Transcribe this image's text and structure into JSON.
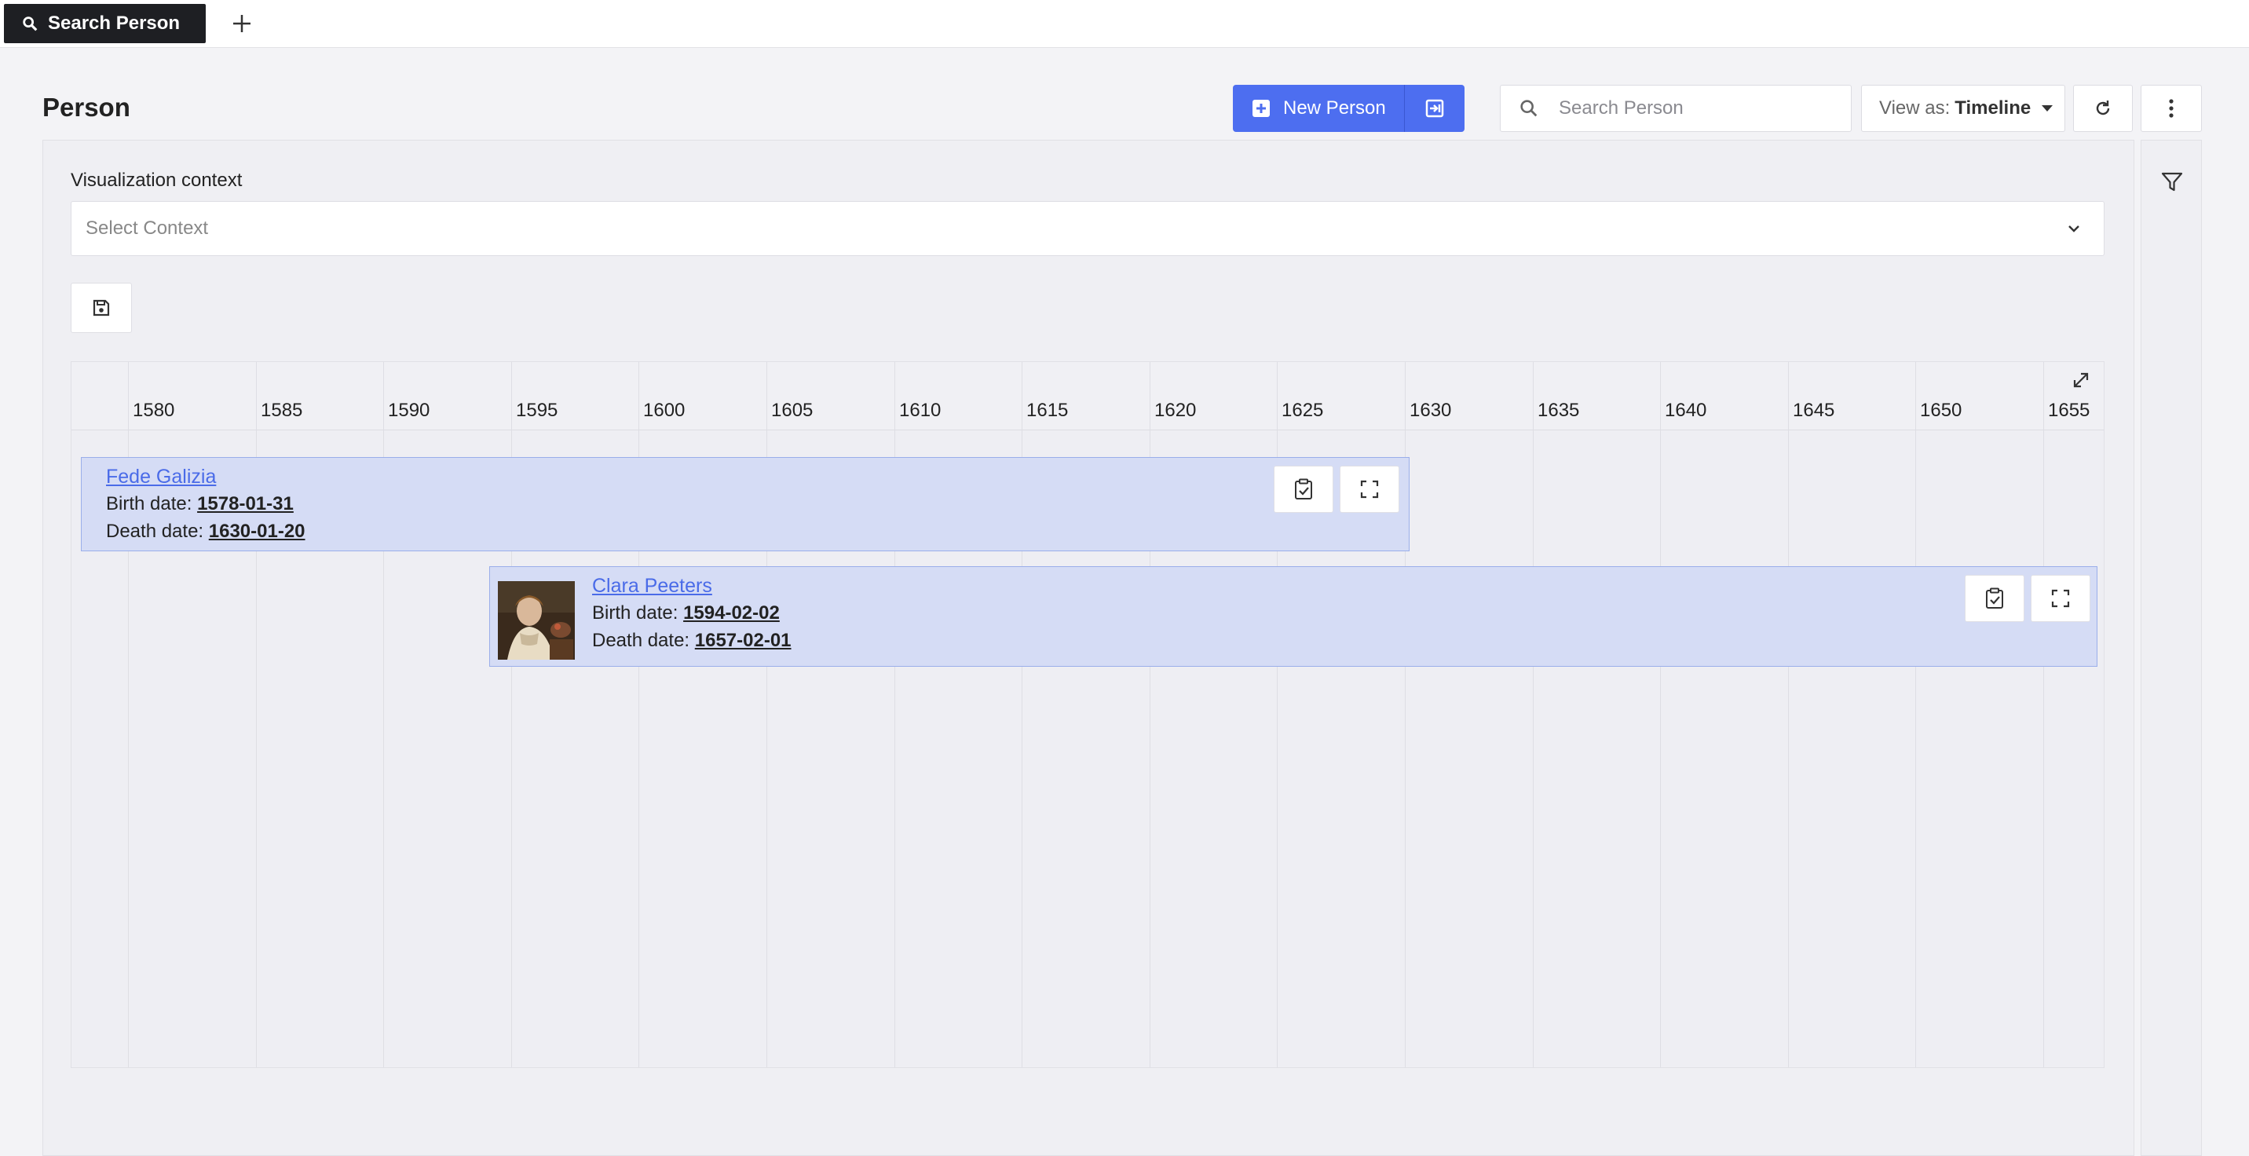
{
  "tabs": {
    "active_label": "Search Person",
    "add_label": "+"
  },
  "header": {
    "title": "Person",
    "new_button_label": "New Person",
    "search_placeholder": "Search Person",
    "view_as_prefix": "View as:",
    "view_as_value": "Timeline"
  },
  "context": {
    "label": "Visualization context",
    "placeholder": "Select Context"
  },
  "timeline": {
    "ticks": [
      "1580",
      "1585",
      "1590",
      "1595",
      "1600",
      "1605",
      "1610",
      "1615",
      "1620",
      "1625",
      "1630",
      "1635",
      "1640",
      "1645",
      "1650",
      "1655"
    ],
    "items": [
      {
        "name": "Fede Galizia",
        "birth_label": "Birth date:",
        "birth": "1578-01-31",
        "death_label": "Death date:",
        "death": "1630-01-20",
        "has_portrait": false
      },
      {
        "name": "Clara Peeters",
        "birth_label": "Birth date:",
        "birth": "1594-02-02",
        "death_label": "Death date:",
        "death": "1657-02-01",
        "has_portrait": true
      }
    ]
  },
  "icons": {
    "tab": "search-icon",
    "new": "plus-square-icon",
    "import": "import-icon",
    "search": "search-icon",
    "refresh": "refresh-icon",
    "more": "vertical-dots-icon",
    "filter": "filter-icon",
    "context": "chevron-down-icon",
    "save": "save-icon",
    "expand": "expand-diagonal-icon",
    "item_actions": [
      "clipboard-check-icon",
      "fullscreen-icon"
    ]
  },
  "colors": {
    "primary": "#4d6ef0",
    "item_fill": "#d5dcf5",
    "item_border": "#9aaeea",
    "link": "#4a6be8",
    "tab_bg": "#1e1f23"
  }
}
